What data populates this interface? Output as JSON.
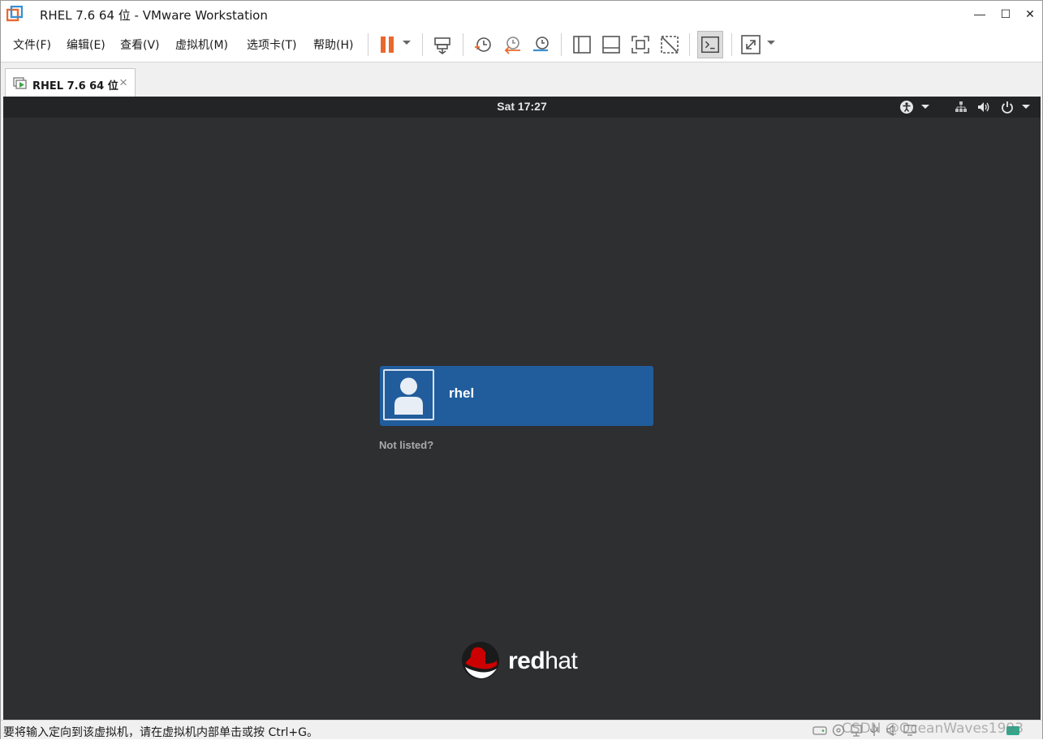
{
  "window": {
    "title": "RHEL 7.6 64 位 - VMware Workstation",
    "minimize_label": "—",
    "maximize_label": "☐",
    "close_label": "✕"
  },
  "menu": {
    "items": [
      {
        "label": "文件(F)"
      },
      {
        "label": "编辑(E)"
      },
      {
        "label": "查看(V)"
      },
      {
        "label": "虚拟机(M)"
      },
      {
        "label": "选项卡(T)"
      },
      {
        "label": "帮助(H)"
      }
    ]
  },
  "toolbar": {
    "accent": "#e8692d",
    "icons": [
      "pause-icon",
      "send-ctrl-alt-del-icon",
      "snapshot-take-icon",
      "snapshot-revert-icon",
      "snapshot-manager-icon",
      "library-view-icon",
      "thumbnail-view-icon",
      "fullscreen-icon",
      "unity-icon",
      "console-view-icon",
      "stretch-guest-icon"
    ]
  },
  "tabs": [
    {
      "label": "RHEL 7.6 64 位",
      "close": "×"
    }
  ],
  "guest": {
    "clock": "Sat 17:27",
    "users": [
      {
        "name": "rhel"
      }
    ],
    "not_listed": "Not listed?",
    "logo": {
      "bold": "red",
      "light": "hat"
    },
    "colors": {
      "background": "#2d2f31",
      "user_card": "#215d9c"
    }
  },
  "status": {
    "message": "要将输入定向到该虚拟机，请在虚拟机内部单击或按 Ctrl+G。",
    "watermark": "CSDN @OceanWaves1993"
  }
}
